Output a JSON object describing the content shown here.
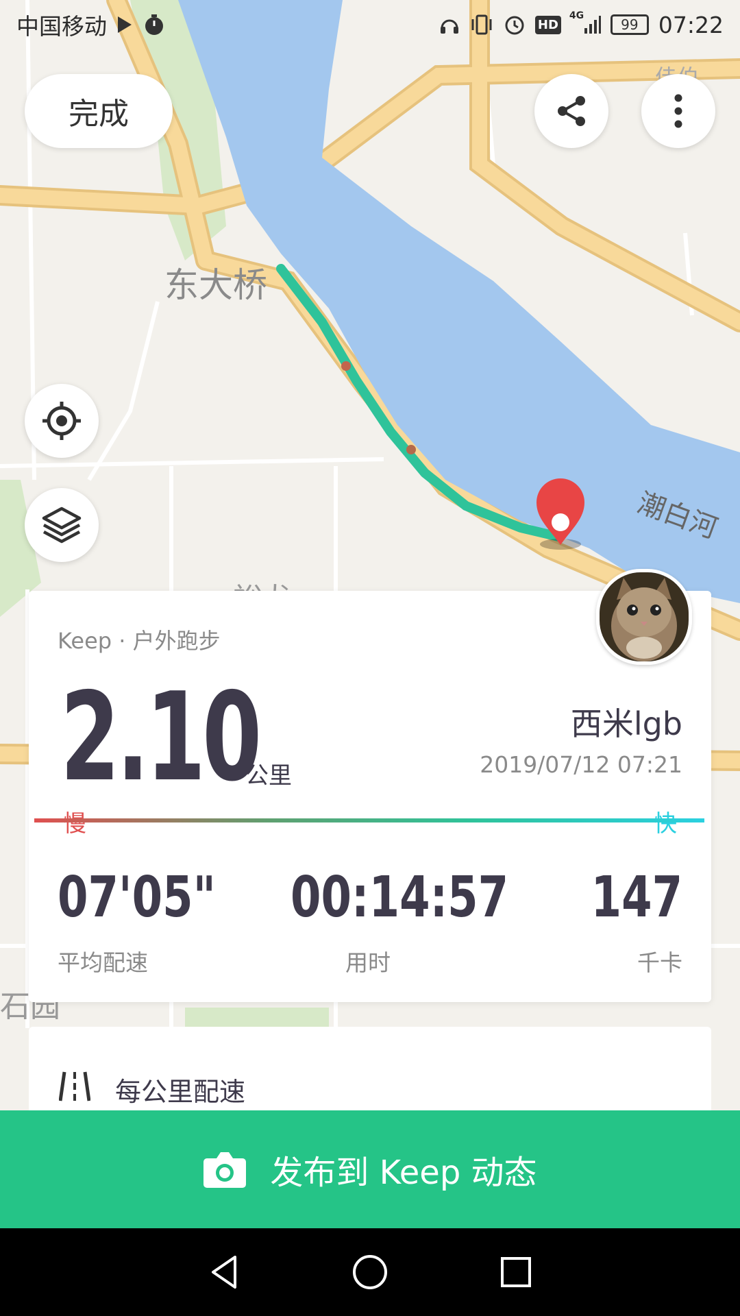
{
  "status_bar": {
    "carrier": "中国移动",
    "network": "4G",
    "hd": "HD",
    "battery": "99",
    "time": "07:22"
  },
  "top": {
    "done_label": "完成"
  },
  "map": {
    "labels": {
      "bridge": "东大桥",
      "river": "潮白河",
      "top_right": "佳伯",
      "bottom_left": "石园",
      "mid_partial": "裕龙"
    }
  },
  "card": {
    "source": "Keep · 户外跑步",
    "distance": "2.10",
    "distance_unit": "公里",
    "user_name": "西米lgb",
    "datetime": "2019/07/12 07:21",
    "slow_label": "慢",
    "fast_label": "快",
    "stats": [
      {
        "value": "07'05\"",
        "label": "平均配速"
      },
      {
        "value": "00:14:57",
        "label": "用时"
      },
      {
        "value": "147",
        "label": "千卡"
      }
    ]
  },
  "splits": {
    "title": "每公里配速"
  },
  "publish": {
    "label": "发布到 Keep 动态"
  },
  "colors": {
    "accent": "#25c487",
    "route": "#2fc39a",
    "river": "#a3c7ee",
    "road": "#f8d99a",
    "pin": "#e84545",
    "slow": "#e05050",
    "fast": "#2bd0e0"
  }
}
